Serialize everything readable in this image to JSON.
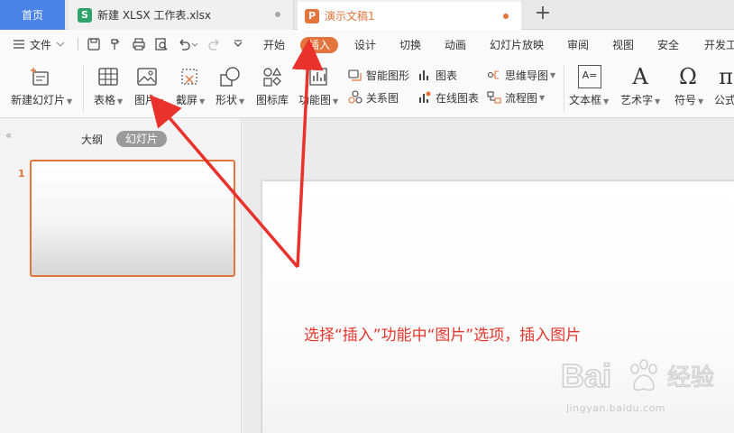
{
  "tabs": {
    "home_label": "首页",
    "xlsx_label": "新建 XLSX 工作表.xlsx",
    "xlsx_icon": "S",
    "ppt_label": "演示文稿1",
    "ppt_icon": "P",
    "new_tab": "+"
  },
  "menubar": {
    "file_label": "文件",
    "tabs": [
      "开始",
      "插入",
      "设计",
      "切换",
      "动画",
      "幻灯片放映",
      "审阅",
      "视图",
      "安全",
      "开发工"
    ],
    "active_tab": "插入"
  },
  "ribbon": {
    "new_slide": "新建幻灯片",
    "table": "表格",
    "picture": "图片",
    "screenshot": "截屏",
    "shape": "形状",
    "icon_lib": "图标库",
    "function_chart": "功能图",
    "smart_art": "智能图形",
    "chart": "图表",
    "relation": "关系图",
    "online_chart": "在线图表",
    "mind_map": "思维导图",
    "flow_chart": "流程图",
    "text_box": "文本框",
    "art_text": "艺术字",
    "symbol": "符号",
    "formula": "公式",
    "text_box_glyph": "A=",
    "art_text_glyph": "A",
    "symbol_glyph": "Ω",
    "formula_glyph": "π"
  },
  "panel": {
    "collapse": "«",
    "outline_tab": "大纲",
    "slides_tab": "幻灯片",
    "slide_number": "1"
  },
  "annotation": {
    "caption": "选择“插入”功能中“图片”选项，插入图片"
  },
  "watermark": {
    "brand": "Bai 经验",
    "url": "jingyan.baidu.com"
  },
  "colors": {
    "accent": "#e2743c",
    "home_tab": "#4a83e8",
    "sheet_icon": "#2fa46a",
    "arrow_red": "#e8322b"
  }
}
